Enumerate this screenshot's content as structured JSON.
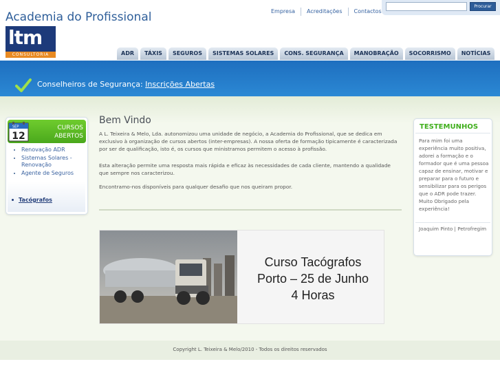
{
  "header": {
    "site_title": "Academia do Profissional",
    "logo_text": "ltm",
    "logo_subtext": "CONSULTORIA",
    "top_links": [
      "Empresa",
      "Acreditações",
      "Contactos"
    ],
    "search": {
      "placeholder": "",
      "button_label": "Procurar"
    }
  },
  "nav": {
    "tabs": [
      "ADR",
      "TÁXIS",
      "SEGUROS",
      "SISTEMAS SOLARES",
      "CONS. SEGURANÇA",
      "MANOBRAÇÃO",
      "SOCORRISMO",
      "NOTÍCIAS"
    ]
  },
  "banner": {
    "text": "Conselheiros de Segurança:",
    "link_text": "Inscrições Abertas"
  },
  "sidebar": {
    "calendar_month": "SEP",
    "calendar_day": "12",
    "title_line1": "CURSOS",
    "title_line2": "ABERTOS",
    "items": [
      "Renovação ADR",
      "Sistemas Solares - Renovação",
      "Agente de Seguros"
    ],
    "highlight_item": "Tacógrafos"
  },
  "main": {
    "heading": "Bem Vindo",
    "paragraphs": [
      "A L. Teixeira & Melo, Lda. autonomizou uma unidade de negócio, a Academia do Profissional, que se dedica em exclusivo à organização de cursos abertos (inter-empresas). A nossa oferta de formação tipicamente é caracterizada por ser de qualificação, isto é, os cursos que ministramos permitem o acesso à profissão.",
      "Esta alteração permite uma resposta mais rápida e eficaz às necessidades de cada cliente, mantendo a qualidade que sempre nos caracterizou.",
      "Encontramo-nos disponíveis para qualquer desafio que nos queiram propor."
    ],
    "promo": {
      "line1": "Curso Tacógrafos",
      "line2": "Porto – 25 de Junho",
      "line3": "4 Horas"
    }
  },
  "testemunhos": {
    "title": "TESTEMUNHOS",
    "quote": "Para mim foi uma experiência muito positiva, adorei a formação e o formador que é uma pessoa capaz de ensinar, motivar e preparar para o futuro e sensibilizar para os perigos que o ADR pode trazer. Muito Obrigado pela experiência!",
    "author": "Joaquim Pinto | Petrofregim"
  },
  "footer": {
    "copyright": "Copyright L. Teixeira & Melo/2010 - Todos os direitos reservados"
  },
  "colors": {
    "brand_blue": "#1d3a7a",
    "banner_blue": "#2b88d4",
    "accent_green": "#4aa81c",
    "logo_orange": "#e98a22"
  }
}
